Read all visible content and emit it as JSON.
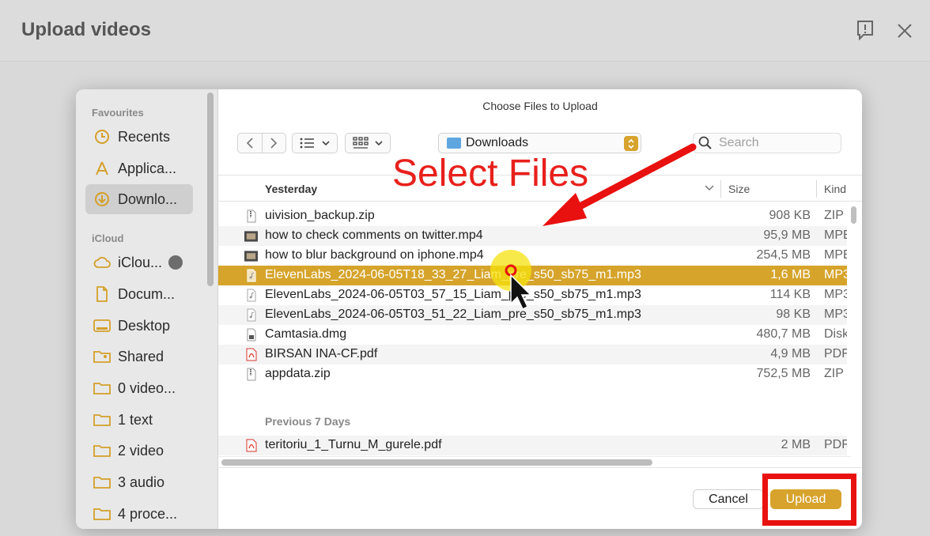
{
  "background": {
    "title": "Upload videos"
  },
  "dialog": {
    "title": "Choose Files to Upload",
    "sidebar": {
      "sections": [
        {
          "label": "Favourites",
          "items": [
            {
              "label": "Recents",
              "icon": "clock-icon",
              "active": false
            },
            {
              "label": "Applica...",
              "icon": "applications-icon",
              "active": false
            },
            {
              "label": "Downlo...",
              "icon": "downloads-icon",
              "active": true
            }
          ]
        },
        {
          "label": "iCloud",
          "items": [
            {
              "label": "iClou...",
              "icon": "cloud-icon",
              "active": false
            },
            {
              "label": "Docum...",
              "icon": "document-icon",
              "active": false
            },
            {
              "label": "Desktop",
              "icon": "desktop-icon",
              "active": false
            },
            {
              "label": "Shared",
              "icon": "shared-folder-icon",
              "active": false
            },
            {
              "label": "0 video...",
              "icon": "folder-icon",
              "active": false
            },
            {
              "label": "1 text",
              "icon": "folder-icon",
              "active": false
            },
            {
              "label": "2 video",
              "icon": "folder-icon",
              "active": false
            },
            {
              "label": "3 audio",
              "icon": "folder-icon",
              "active": false
            },
            {
              "label": "4 proce...",
              "icon": "folder-icon",
              "active": false
            }
          ]
        }
      ]
    },
    "toolbar": {
      "location": "Downloads",
      "search_placeholder": "Search"
    },
    "columns": {
      "name": "Yesterday",
      "size": "Size",
      "kind": "Kind"
    },
    "groups": [
      {
        "label": "",
        "files": [
          {
            "name": "uivision_backup.zip",
            "size": "908 KB",
            "kind": "ZIP",
            "icon": "zip-icon"
          },
          {
            "name": "how to check comments on twitter.mp4",
            "size": "95,9 MB",
            "kind": "MPE",
            "icon": "video-thumbnail-icon"
          },
          {
            "name": "how to blur background on iphone.mp4",
            "size": "254,5 MB",
            "kind": "MPE",
            "icon": "video-thumbnail-icon"
          },
          {
            "name": "ElevenLabs_2024-06-05T18_33_27_Liam_pre_s50_sb75_m1.mp3",
            "size": "1,6 MB",
            "kind": "MP3",
            "icon": "audio-file-icon",
            "selected": true
          },
          {
            "name": "ElevenLabs_2024-06-05T03_57_15_Liam_pre_s50_sb75_m1.mp3",
            "size": "114 KB",
            "kind": "MP3",
            "icon": "audio-file-icon"
          },
          {
            "name": "ElevenLabs_2024-06-05T03_51_22_Liam_pre_s50_sb75_m1.mp3",
            "size": "98 KB",
            "kind": "MP3",
            "icon": "audio-file-icon"
          },
          {
            "name": "Camtasia.dmg",
            "size": "480,7 MB",
            "kind": "Disk",
            "icon": "disk-image-icon"
          },
          {
            "name": "BIRSAN INA-CF.pdf",
            "size": "4,9 MB",
            "kind": "PDF",
            "icon": "pdf-icon"
          },
          {
            "name": "appdata.zip",
            "size": "752,5 MB",
            "kind": "ZIP",
            "icon": "zip-icon"
          }
        ]
      },
      {
        "label": "Previous 7 Days",
        "files": [
          {
            "name": "teritoriu_1_Turnu_M_gurele.pdf",
            "size": "2 MB",
            "kind": "PDF",
            "icon": "pdf-icon"
          }
        ]
      }
    ],
    "buttons": {
      "cancel": "Cancel",
      "upload": "Upload"
    }
  },
  "annotation": {
    "text": "Select Files",
    "color": "#e8201c"
  },
  "colors": {
    "accent": "#d7a32c",
    "selection": "#d6a42b",
    "annotation_red": "#e8110f"
  }
}
